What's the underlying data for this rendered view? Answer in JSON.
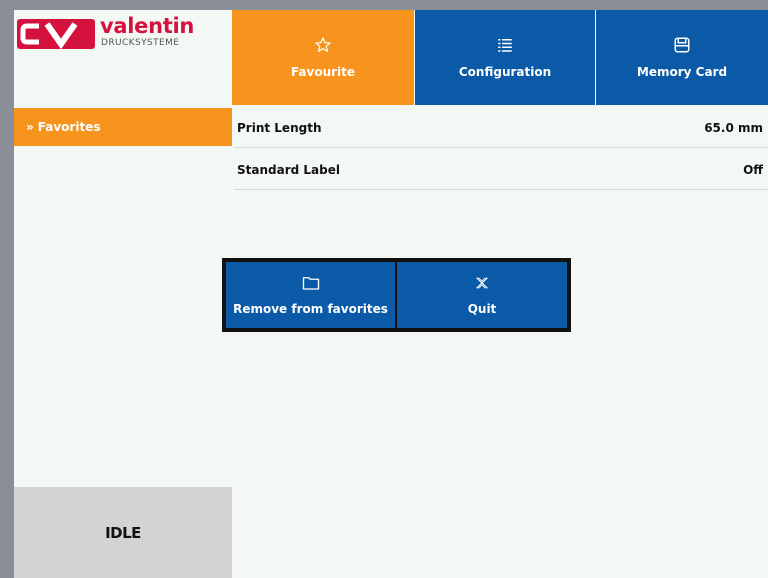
{
  "brand": {
    "name": "valentin",
    "subtitle": "DRUCKSYSTEME",
    "mark": "CV"
  },
  "tabs": [
    {
      "label": "Favourite",
      "icon": "star-icon",
      "active": true
    },
    {
      "label": "Configuration",
      "icon": "list-icon",
      "active": false
    },
    {
      "label": "Memory Card",
      "icon": "save-icon",
      "active": false
    }
  ],
  "sidebar": {
    "items": [
      {
        "label": "Favorites",
        "icon": "double-chevron-right-icon"
      }
    ]
  },
  "settings": [
    {
      "label": "Print Length",
      "value": "65.0 mm"
    },
    {
      "label": "Standard Label",
      "value": "Off"
    }
  ],
  "dialog": {
    "remove_label": "Remove from favorites",
    "quit_label": "Quit"
  },
  "status": {
    "text": "IDLE"
  },
  "colors": {
    "accent": "#f7941d",
    "primary": "#0a5aa8",
    "brand": "#d5123e"
  }
}
